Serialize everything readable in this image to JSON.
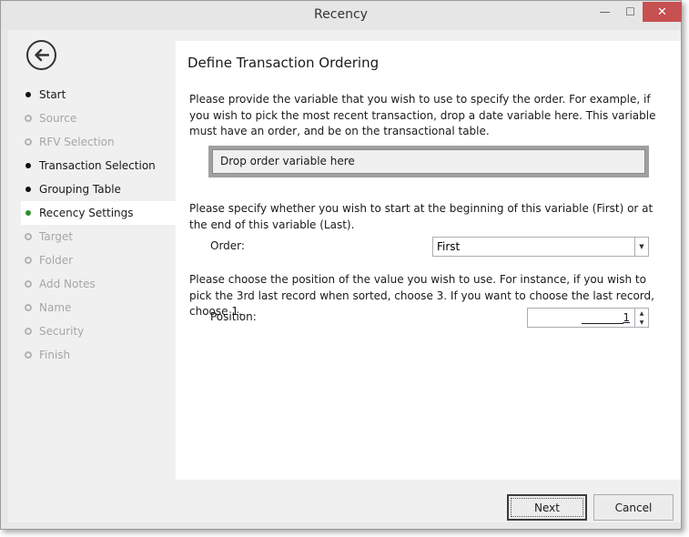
{
  "window": {
    "title": "Recency",
    "minimize_glyph": "—",
    "maximize_glyph": "☐",
    "close_glyph": "✕"
  },
  "sidebar": {
    "back_icon": "back-arrow-icon",
    "items": [
      {
        "label": "Start",
        "state": "done"
      },
      {
        "label": "Source",
        "state": "disabled"
      },
      {
        "label": "RFV Selection",
        "state": "disabled"
      },
      {
        "label": "Transaction Selection",
        "state": "done"
      },
      {
        "label": "Grouping Table",
        "state": "done"
      },
      {
        "label": "Recency Settings",
        "state": "active"
      },
      {
        "label": "Target",
        "state": "disabled"
      },
      {
        "label": "Folder",
        "state": "disabled"
      },
      {
        "label": "Add Notes",
        "state": "disabled"
      },
      {
        "label": "Name",
        "state": "disabled"
      },
      {
        "label": "Security",
        "state": "disabled"
      },
      {
        "label": "Finish",
        "state": "disabled"
      }
    ]
  },
  "main": {
    "heading": "Define Transaction Ordering",
    "intro": "Please provide the variable that you wish to use to specify the order. For example, if you wish to pick the most recent transaction, drop a date variable here. This variable must have an order, and be on the transactional table.",
    "drop_zone": "Drop order variable here",
    "order_description": "Please specify whether you wish to start at the beginning of this variable (First) or at the end of this variable (Last).",
    "order_label": "Order:",
    "order_value": "First",
    "position_description": "Please choose the position of the value you wish to use. For instance, if you wish to pick the 3rd last record when sorted, choose 3. If you want to choose the last record, choose 1.",
    "position_label": "Position:",
    "position_value": "1"
  },
  "footer": {
    "next_label": "Next",
    "cancel_label": "Cancel"
  },
  "colors": {
    "close_button": "#c75050",
    "active_dot": "#2f8f2f",
    "drop_zone_border": "#a0a0a0"
  }
}
